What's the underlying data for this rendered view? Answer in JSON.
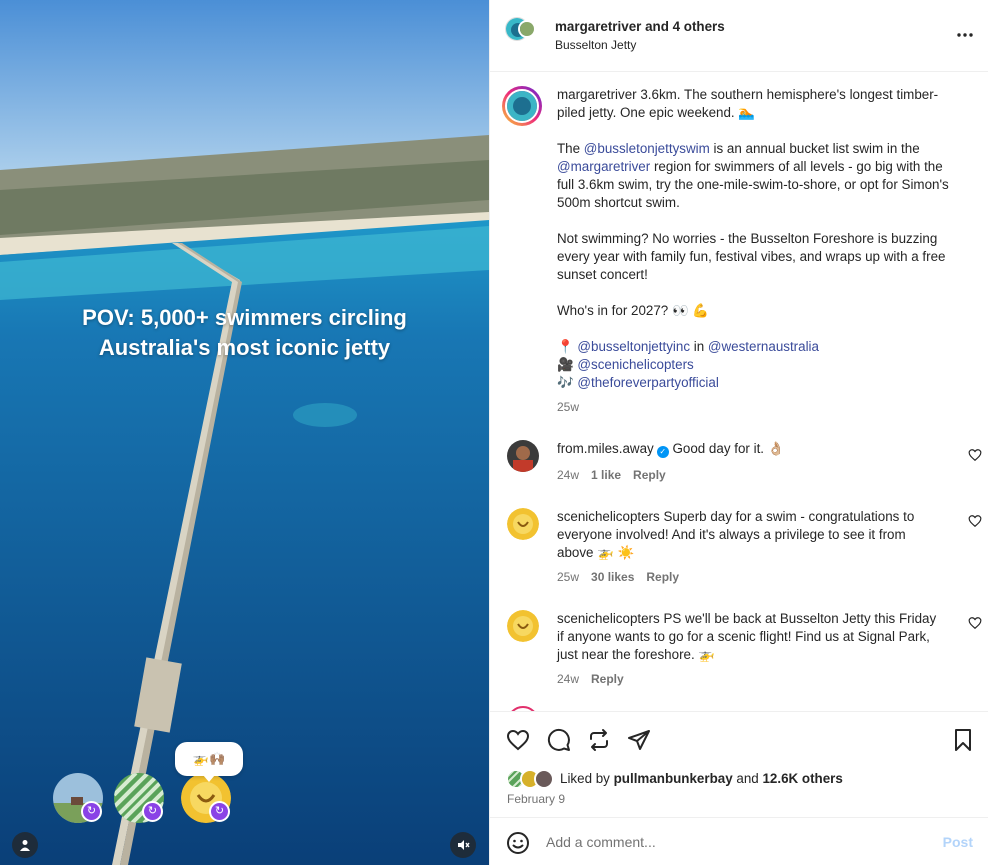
{
  "media": {
    "overlay_line1": "POV: 5,000+ swimmers circling",
    "overlay_line2": "Australia's most iconic jetty",
    "bubble_emoji": "🚁🙌🏽",
    "mute_icon": "speaker-muted-icon",
    "tag_icon": "person-tag-icon"
  },
  "header": {
    "username": "margaretriver",
    "and_others": " and 4 others",
    "location": "Busselton Jetty",
    "more_icon": "more-dots-icon"
  },
  "caption": {
    "username": "margaretriver",
    "line1": " 3.6km. The southern hemisphere's longest timber-piled jetty. One epic weekend. 🏊",
    "p2_before": "The ",
    "p2_mention1": "@bussletonjettyswim",
    "p2_mid": " is an annual bucket list swim in the ",
    "p2_mention2": "@margaretriver",
    "p2_after": " region for swimmers of all levels - go big with the full 3.6km swim, try the one-mile-swim-to-shore, or opt for Simon's 500m shortcut swim.",
    "p3": "Not swimming? No worries - the Busselton Foreshore is buzzing every year with family fun, festival vibes, and wraps up with a free sunset concert!",
    "p4": "Who's in for 2027? 👀 💪",
    "credit1_emoji": "📍",
    "credit1_mention": "@busseltonjettyinc",
    "credit1_in": " in ",
    "credit1_place": "@westernaustralia",
    "credit2_emoji": "🎥",
    "credit2_mention": "@scenichelicopters",
    "credit3_emoji": "🎶",
    "credit3_mention": "@theforeverpartyofficial",
    "time": "25w"
  },
  "comments": [
    {
      "username": "from.miles.away",
      "verified": true,
      "text": " Good day for it. 👌🏼",
      "time": "24w",
      "likes": "1 like",
      "reply": "Reply"
    },
    {
      "username": "scenichelicopters",
      "verified": false,
      "text": " Superb day for a swim - congratulations to everyone involved! And it's always a privilege to see it from above 🚁 ☀️",
      "time": "25w",
      "likes": "30 likes",
      "reply": "Reply"
    },
    {
      "username": "scenichelicopters",
      "verified": false,
      "text": " PS we'll be back at Busselton Jetty this Friday if anyone wants to go for a scenic flight! Find us at Signal Park, just near the foreshore. 🚁",
      "time": "24w",
      "likes": "",
      "reply": "Reply"
    }
  ],
  "actions": {
    "like_icon": "heart-icon",
    "comment_icon": "comment-bubble-icon",
    "repost_icon": "repost-icon",
    "share_icon": "send-paper-plane-icon",
    "save_icon": "bookmark-icon"
  },
  "likes": {
    "prefix": "Liked by ",
    "user": "pullmanbunkerbay",
    "mid": " and ",
    "count": "12.6K others"
  },
  "date": "February 9",
  "add_comment": {
    "emoji_icon": "smiley-face-icon",
    "placeholder": "Add a comment...",
    "post_label": "Post"
  },
  "colors": {
    "link": "#3a4b9a",
    "verified": "#0095f6",
    "post_disabled": "#b3d4fa",
    "collab_badge": "#8a43e6"
  }
}
